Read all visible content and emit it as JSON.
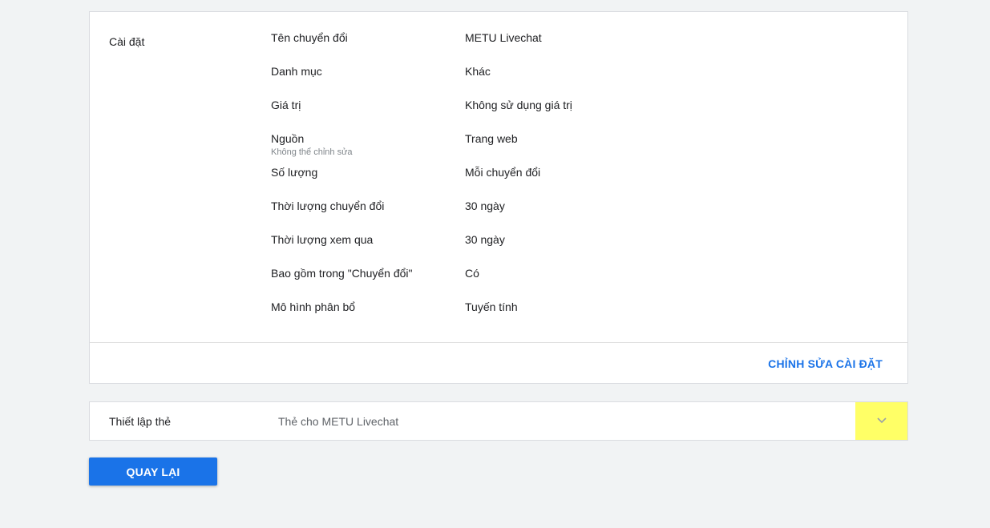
{
  "settings_card": {
    "section_title": "Cài đặt",
    "rows": [
      {
        "label": "Tên chuyển đổi",
        "value": "METU Livechat",
        "note": ""
      },
      {
        "label": "Danh mục",
        "value": "Khác",
        "note": ""
      },
      {
        "label": "Giá trị",
        "value": "Không sử dụng giá trị",
        "note": ""
      },
      {
        "label": "Nguồn",
        "value": "Trang web",
        "note": "Không thể chỉnh sửa"
      },
      {
        "label": "Số lượng",
        "value": "Mỗi chuyển đổi",
        "note": ""
      },
      {
        "label": "Thời lượng chuyển đổi",
        "value": "30 ngày",
        "note": ""
      },
      {
        "label": "Thời lượng xem qua",
        "value": "30 ngày",
        "note": ""
      },
      {
        "label": "Bao gồm trong \"Chuyển đổi\"",
        "value": "Có",
        "note": ""
      },
      {
        "label": "Mô hình phân bổ",
        "value": "Tuyến tính",
        "note": ""
      }
    ],
    "edit_label": "CHỈNH SỬA CÀI ĐẶT"
  },
  "tag_setup": {
    "label": "Thiết lập thẻ",
    "value": "Thẻ cho METU Livechat",
    "expand_icon": "chevron-down-icon",
    "highlight_color": "#ffff66"
  },
  "back_button": {
    "label": "QUAY LẠI"
  },
  "colors": {
    "accent": "#1a73e8",
    "background": "#f1f3f4"
  }
}
